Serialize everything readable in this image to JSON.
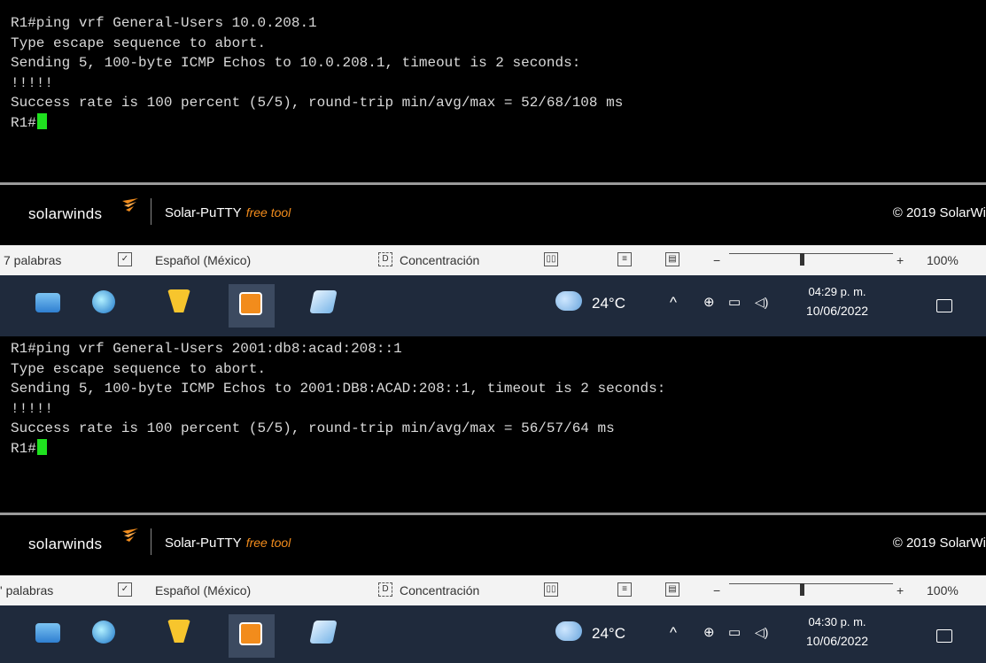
{
  "top": {
    "terminal_lines": [
      "R1#ping vrf General-Users 10.0.208.1",
      "Type escape sequence to abort.",
      "Sending 5, 100-byte ICMP Echos to 10.0.208.1, timeout is 2 seconds:",
      "!!!!!",
      "Success rate is 100 percent (5/5), round-trip min/avg/max = 52/68/108 ms",
      "R1#"
    ],
    "clock_time": "04:29 p. m.",
    "clock_date": "10/06/2022"
  },
  "bottom": {
    "terminal_lines": [
      "R1#ping vrf General-Users 2001:db8:acad:208::1",
      "Type escape sequence to abort.",
      "Sending 5, 100-byte ICMP Echos to 2001:DB8:ACAD:208::1, timeout is 2 seconds:",
      "!!!!!",
      "Success rate is 100 percent (5/5), round-trip min/avg/max = 56/57/64 ms",
      "R1#"
    ],
    "clock_time": "04:30 p. m.",
    "clock_date": "10/06/2022"
  },
  "brand": {
    "logo": "solarwinds",
    "product": "Solar-PuTTY",
    "free_tag": "free tool",
    "copyright": "© 2019 SolarWi"
  },
  "statusbar_top": {
    "words": "7 palabras",
    "language": "Español (México)",
    "focus": "Concentración",
    "zoom": "100%",
    "minus": "−",
    "plus": "+"
  },
  "statusbar_bottom": {
    "words": "' palabras",
    "language": "Español (México)",
    "focus": "Concentración",
    "zoom": "100%",
    "minus": "−",
    "plus": "+"
  },
  "weather": {
    "temp": "24°C"
  },
  "icons": {
    "word_count": "proofing-icon",
    "focus": "focus-icon",
    "read_mode": "read-mode-icon",
    "print_layout": "print-layout-icon",
    "web_layout": "web-layout-icon",
    "weather": "cloud-rain-icon",
    "chevron": "chevron-up-icon",
    "network": "network-icon",
    "volume": "volume-icon",
    "notifications": "notification-icon"
  },
  "colors": {
    "cursor": "#1fe11f",
    "free_tag": "#f28c1c",
    "taskbar": "#1f2a3c"
  }
}
